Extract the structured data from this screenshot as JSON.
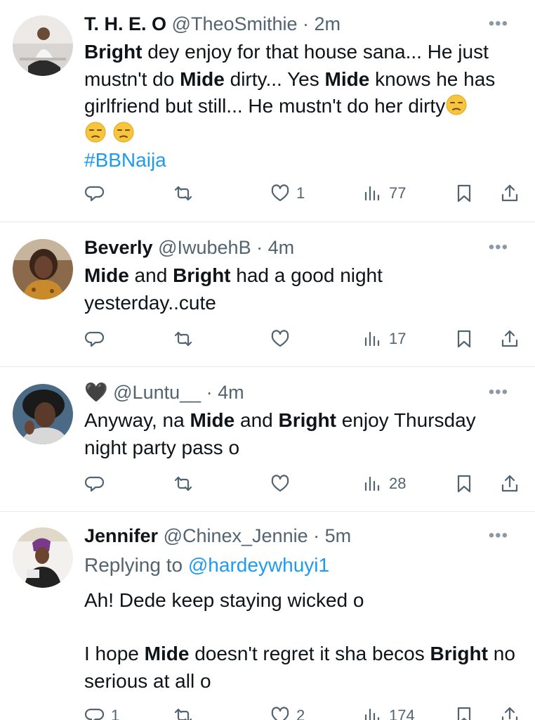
{
  "tweets": [
    {
      "name": "T. H. E. O",
      "handle": "@TheoSmithie",
      "time": "2m",
      "segments": [
        "Bright",
        " dey enjoy for that house sana... He just mustn't do ",
        "Mide",
        " dirty... Yes ",
        "Mide",
        " knows he has girlfriend but still... He mustn't do her dirty"
      ],
      "hashtag": "#BBNaija",
      "reply_count": "",
      "retweet_count": "",
      "like_count": "1",
      "view_count": "77"
    },
    {
      "name": "Beverly",
      "handle": "@IwubehB",
      "time": "4m",
      "segments": [
        "Mide",
        " and ",
        "Bright",
        " had a good night yesterday..cute"
      ],
      "reply_count": "",
      "retweet_count": "",
      "like_count": "",
      "view_count": "17"
    },
    {
      "name": "🖤",
      "handle": "@Luntu__",
      "time": "4m",
      "segments": [
        "Anyway, na ",
        "Mide",
        " and ",
        "Bright",
        " enjoy Thursday night party pass o"
      ],
      "reply_count": "",
      "retweet_count": "",
      "like_count": "",
      "view_count": "28"
    },
    {
      "name": "Jennifer",
      "handle": "@Chinex_Jennie",
      "time": "5m",
      "replying_prefix": "Replying to ",
      "replying_to": "@hardeywhuyi1",
      "line1": "Ah! Dede keep staying wicked o",
      "segments": [
        "I hope ",
        "Mide",
        " doesn't regret it sha becos ",
        "Bright",
        " no serious at all o"
      ],
      "reply_count": "1",
      "retweet_count": "",
      "like_count": "2",
      "view_count": "174"
    }
  ],
  "separator": " · ",
  "more_label": "•••",
  "icons": [
    "reply-icon",
    "retweet-icon",
    "like-icon",
    "views-icon",
    "bookmark-icon",
    "share-icon",
    "unamused-face-emoji"
  ],
  "colors": {
    "link": "#1d9bf0",
    "secondary": "#536471",
    "text": "#0f1419",
    "divider": "#e6e9eb"
  }
}
